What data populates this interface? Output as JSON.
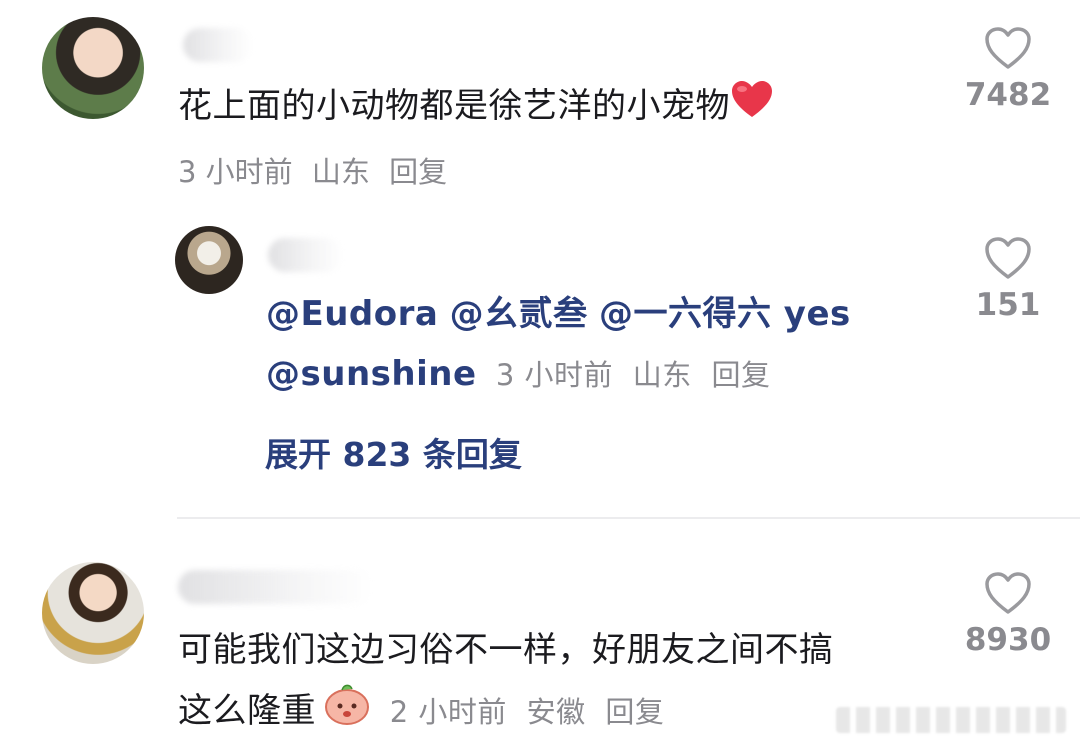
{
  "comments": [
    {
      "text": "花上面的小动物都是徐艺洋的小宠物",
      "time": "3 小时前",
      "location": "山东",
      "reply_label": "回复",
      "likes": "7482",
      "emoji": "red-heart"
    },
    {
      "mentions": [
        "@Eudora",
        "@幺贰叁",
        "@一六得六 yes",
        "@sunshine"
      ],
      "time": "3 小时前",
      "location": "山东",
      "reply_label": "回复",
      "likes": "151",
      "expand_label": "展开 823 条回复"
    },
    {
      "text_line1": "可能我们这边习俗不一样，好朋友之间不搞",
      "text_line2": "这么隆重",
      "time": "2 小时前",
      "location": "安徽",
      "reply_label": "回复",
      "likes": "8930",
      "emoji": "peach-face"
    }
  ],
  "colors": {
    "mention": "#2a3f7c",
    "meta": "#8a8a8f",
    "heart": "#e8364a"
  }
}
